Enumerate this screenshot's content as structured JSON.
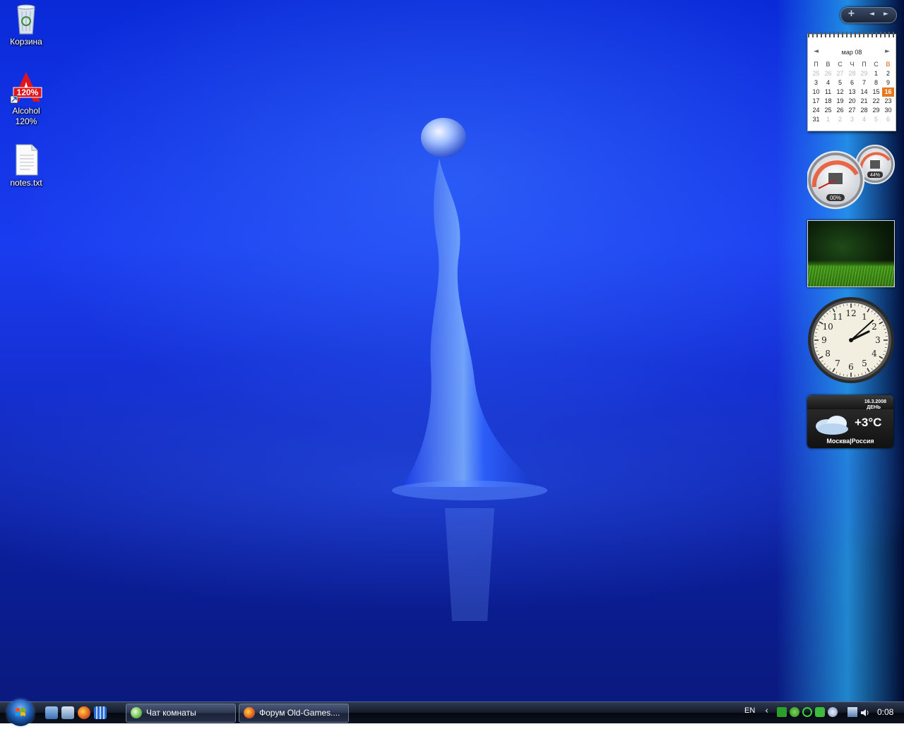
{
  "desktop": {
    "icons": [
      {
        "label": "Корзина",
        "icon": "recycle-bin-icon"
      },
      {
        "label": "Alcohol 120%",
        "icon": "alcohol-120-icon"
      },
      {
        "label": "notes.txt",
        "icon": "text-file-icon"
      }
    ]
  },
  "sidebar": {
    "controls": {
      "add": "+",
      "prev": "◄",
      "next": "►"
    },
    "calendar": {
      "month_label": "мар 08",
      "weekdays": [
        "П",
        "В",
        "С",
        "Ч",
        "П",
        "С",
        "В"
      ],
      "weeks": [
        [
          "25",
          "26",
          "27",
          "28",
          "29",
          "1",
          "2"
        ],
        [
          "3",
          "4",
          "5",
          "6",
          "7",
          "8",
          "9"
        ],
        [
          "10",
          "11",
          "12",
          "13",
          "14",
          "15",
          "16"
        ],
        [
          "17",
          "18",
          "19",
          "20",
          "21",
          "22",
          "23"
        ],
        [
          "24",
          "25",
          "26",
          "27",
          "28",
          "29",
          "30"
        ],
        [
          "31",
          "1",
          "2",
          "3",
          "4",
          "5",
          "6"
        ]
      ],
      "today": "16"
    },
    "cpu_meter": {
      "cpu": "00%",
      "memory": "44%"
    },
    "clock": {
      "numbers": [
        "12",
        "1",
        "2",
        "3",
        "4",
        "5",
        "6",
        "7",
        "8",
        "9",
        "10",
        "11"
      ],
      "hour": 2,
      "minute": 8
    },
    "weather": {
      "date": "16.3.2008",
      "daypart": "ДЕНЬ",
      "temp": "+3°C",
      "city": "Москва|Россия"
    }
  },
  "taskbar": {
    "tasks": [
      {
        "label": "Чат комнаты",
        "icon": "chat-bubbles-icon"
      },
      {
        "label": "Форум Old-Games....",
        "icon": "firefox-icon"
      }
    ],
    "language": "EN",
    "clock": "0:08",
    "colors": {
      "accent": "#1e5fb8",
      "taskbar": "#151c2b"
    }
  }
}
